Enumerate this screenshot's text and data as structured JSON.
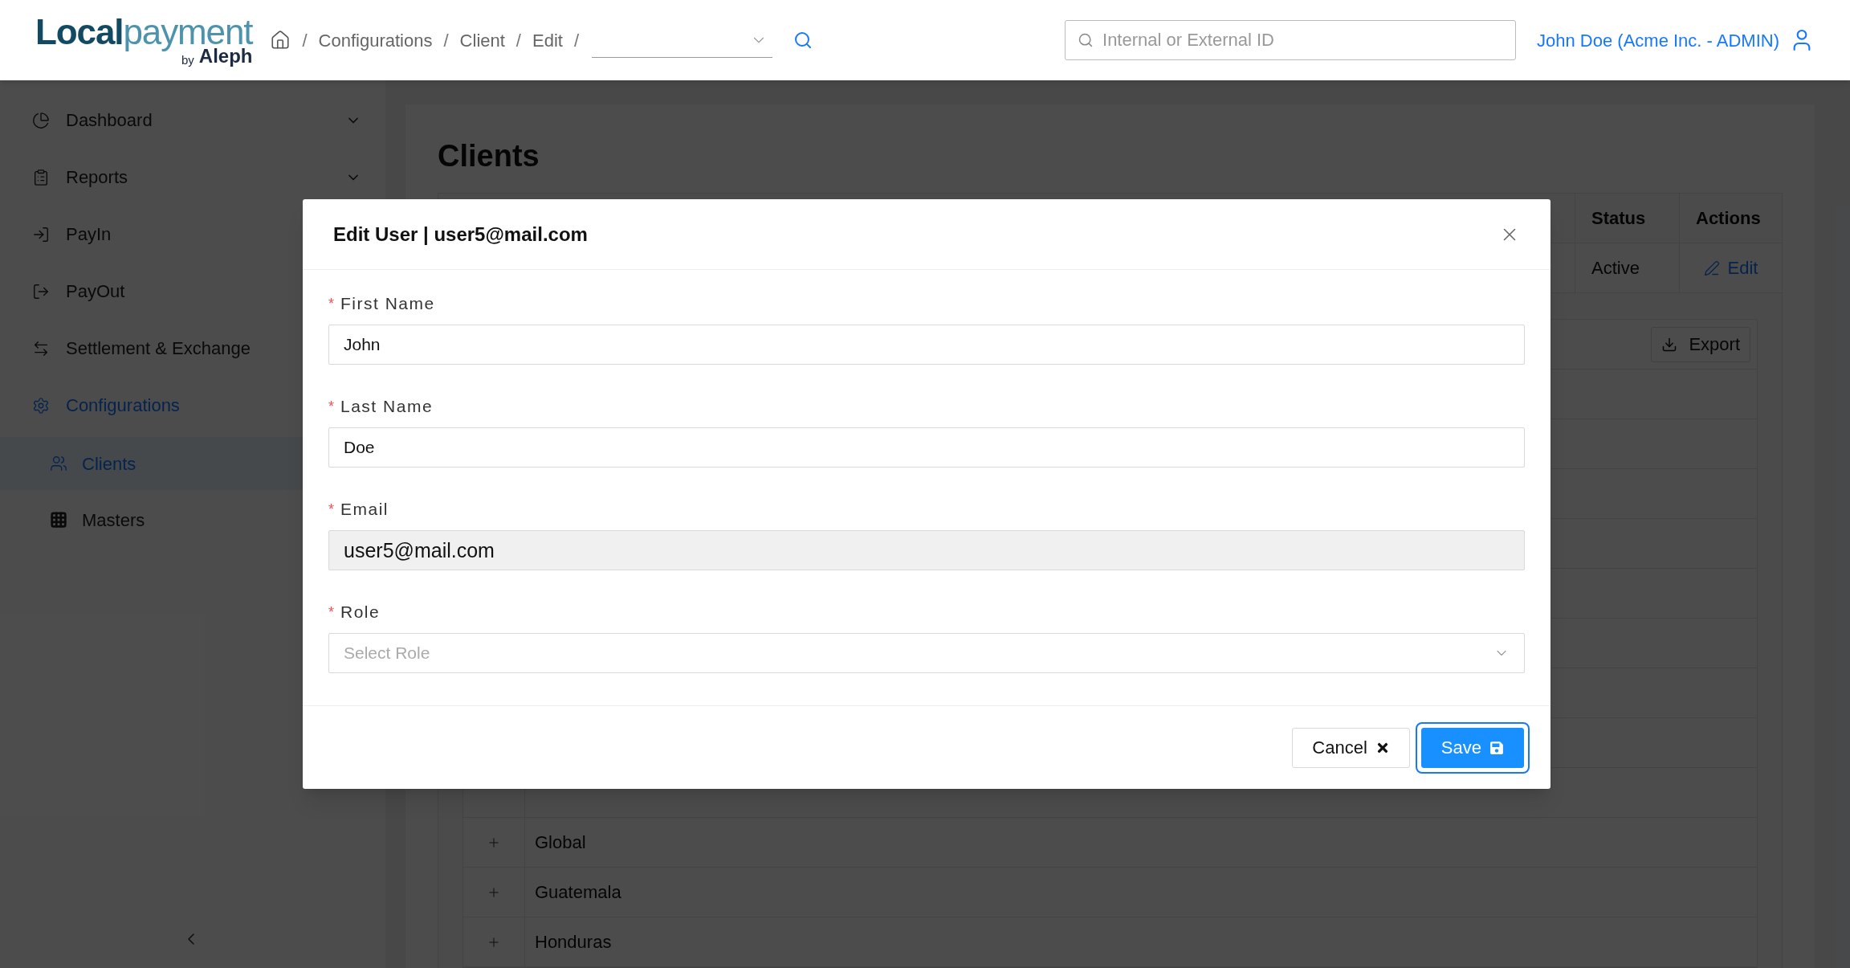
{
  "header": {
    "logo": {
      "first": "Local",
      "second": "payment",
      "by": "by",
      "brand": "Aleph"
    },
    "breadcrumbs": [
      {
        "separator": "/",
        "label": "Configurations"
      },
      {
        "separator": "/",
        "label": "Client"
      },
      {
        "separator": "/",
        "label": "Edit"
      }
    ],
    "trailing_separator": "/",
    "search": {
      "placeholder": "Internal or External ID"
    },
    "user": "John Doe (Acme Inc. - ADMIN)"
  },
  "sidebar": {
    "items": [
      {
        "label": "Dashboard",
        "expandable": true,
        "active": false
      },
      {
        "label": "Reports",
        "expandable": true,
        "active": false
      },
      {
        "label": "PayIn",
        "active": false
      },
      {
        "label": "PayOut",
        "active": false
      },
      {
        "label": "Settlement & Exchange",
        "active": false
      },
      {
        "label": "Configurations",
        "active": true,
        "children": [
          {
            "label": "Clients",
            "selected": true
          },
          {
            "label": "Masters",
            "selected": false
          }
        ]
      }
    ]
  },
  "page": {
    "title": "Clients",
    "table": {
      "columns": [
        "Status",
        "Actions"
      ],
      "rows": [
        {
          "status": "Active",
          "action": "Edit"
        }
      ]
    },
    "export": "Export",
    "countries": [
      "Global",
      "Guatemala",
      "Honduras"
    ]
  },
  "modal": {
    "title": "Edit User | user5@mail.com",
    "fields": [
      {
        "label": "First Name",
        "required": true,
        "required_mark": "*",
        "kind": "text",
        "value": "John",
        "disabled": false
      },
      {
        "label": "Last Name",
        "required": true,
        "required_mark": "*",
        "kind": "text",
        "value": "Doe",
        "disabled": false
      },
      {
        "label": "Email",
        "required": true,
        "required_mark": "*",
        "kind": "text",
        "value": "user5@mail.com",
        "disabled": true
      },
      {
        "label": "Role",
        "required": true,
        "required_mark": "*",
        "kind": "select",
        "placeholder": "Select Role"
      }
    ],
    "buttons": [
      {
        "label": "Cancel",
        "kind": "default",
        "focused": false
      },
      {
        "label": "Save",
        "kind": "primary",
        "focused": true
      }
    ]
  }
}
